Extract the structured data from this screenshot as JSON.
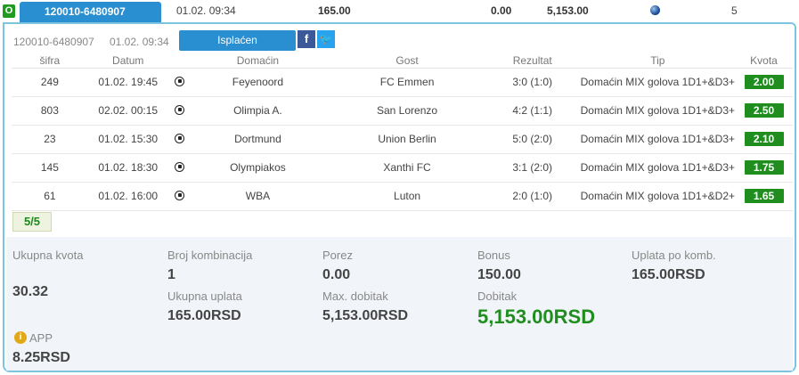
{
  "top": {
    "status": "O",
    "ticket_id": "120010-6480907",
    "datetime": "01.02. 09:34",
    "stake": "165.00",
    "zero": "0.00",
    "win": "5,153.00",
    "count": "5"
  },
  "ticket": {
    "id": "120010-6480907",
    "datetime": "01.02. 09:34",
    "status_button": "Isplaćen",
    "fb": "f",
    "tw": "🐦"
  },
  "table": {
    "headers": [
      "šifra",
      "Datum",
      "Domaćin",
      "Gost",
      "Rezultat",
      "Tip",
      "Kvota"
    ],
    "rows": [
      {
        "code": "249",
        "date": "01.02. 19:45",
        "home": "Feyenoord",
        "away": "FC Emmen",
        "result": "3:0 (1:0)",
        "tip": "Domaćin MIX golova 1D1+&D3+",
        "odd": "2.00"
      },
      {
        "code": "803",
        "date": "02.02. 00:15",
        "home": "Olimpia A.",
        "away": "San Lorenzo",
        "result": "4:2 (1:1)",
        "tip": "Domaćin MIX golova 1D1+&D3+",
        "odd": "2.50"
      },
      {
        "code": "23",
        "date": "01.02. 15:30",
        "home": "Dortmund",
        "away": "Union Berlin",
        "result": "5:0 (2:0)",
        "tip": "Domaćin MIX golova 1D1+&D3+",
        "odd": "2.10"
      },
      {
        "code": "145",
        "date": "01.02. 18:30",
        "home": "Olympiakos",
        "away": "Xanthi FC",
        "result": "3:1 (2:0)",
        "tip": "Domaćin MIX golova 1D1+&D3+",
        "odd": "1.75"
      },
      {
        "code": "61",
        "date": "01.02. 16:00",
        "home": "WBA",
        "away": "Luton",
        "result": "2:0 (1:0)",
        "tip": "Domaćin MIX golova 1D1+&D2+",
        "odd": "1.65"
      }
    ]
  },
  "count_badge": "5/5",
  "summary": {
    "total_odds_label": "Ukupna kvota",
    "total_odds": "30.32",
    "combos_label": "Broj kombinacija",
    "combos": "1",
    "tax_label": "Porez",
    "tax": "0.00",
    "bonus_label": "Bonus",
    "bonus": "150.00",
    "stake_per_combo_label": "Uplata po komb.",
    "stake_per_combo": "165.00RSD",
    "total_stake_label": "Ukupna uplata",
    "total_stake": "165.00RSD",
    "max_win_label": "Max. dobitak",
    "max_win": "5,153.00RSD",
    "win_label": "Dobitak",
    "win": "5,153.00RSD",
    "app_icon": "i",
    "app_label": "APP",
    "app_value": "8.25RSD"
  },
  "colors": {
    "accent_blue": "#2a8fd0",
    "win_green": "#1f8e1f",
    "panel_border": "#7cc4e0"
  }
}
